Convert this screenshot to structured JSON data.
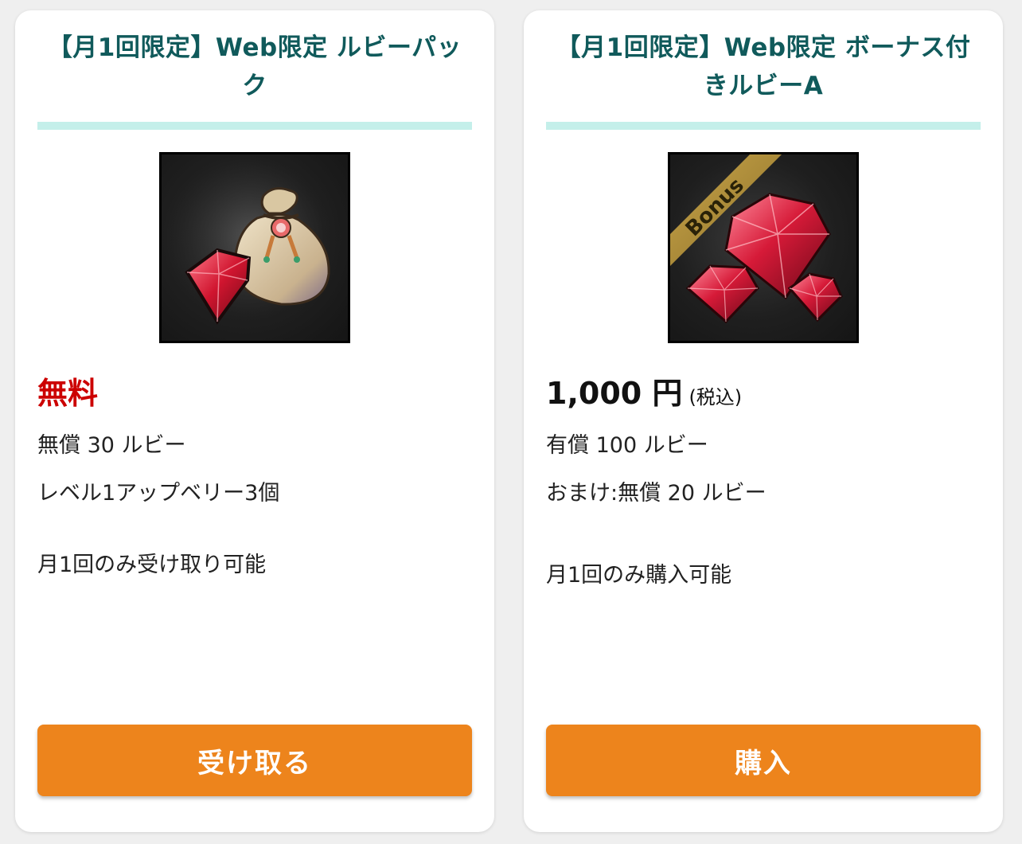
{
  "cards": [
    {
      "title": "【月1回限定】Web限定 ルビーパック",
      "image_icon": "ruby-bag-icon",
      "price_label": "無料",
      "details": [
        "無償 30 ルビー",
        "レベル1アップベリー3個"
      ],
      "limit_text": "月1回のみ受け取り可能",
      "button_label": "受け取る"
    },
    {
      "title": "【月1回限定】Web限定 ボーナス付きルビーA",
      "image_icon": "bonus-rubies-icon",
      "image_badge": "Bonus",
      "price_amount": "1,000 円",
      "price_tax": "(税込)",
      "details": [
        "有償 100 ルビー",
        "おまけ:無償 20 ルビー"
      ],
      "limit_text": "月1回のみ購入可能",
      "button_label": "購入"
    }
  ],
  "colors": {
    "page_background": "#efefef",
    "title_text": "#105a5b",
    "divider": "#c4efea",
    "free_price": "#cc0000",
    "button": "#ed841c",
    "button_text": "#ffffff"
  }
}
